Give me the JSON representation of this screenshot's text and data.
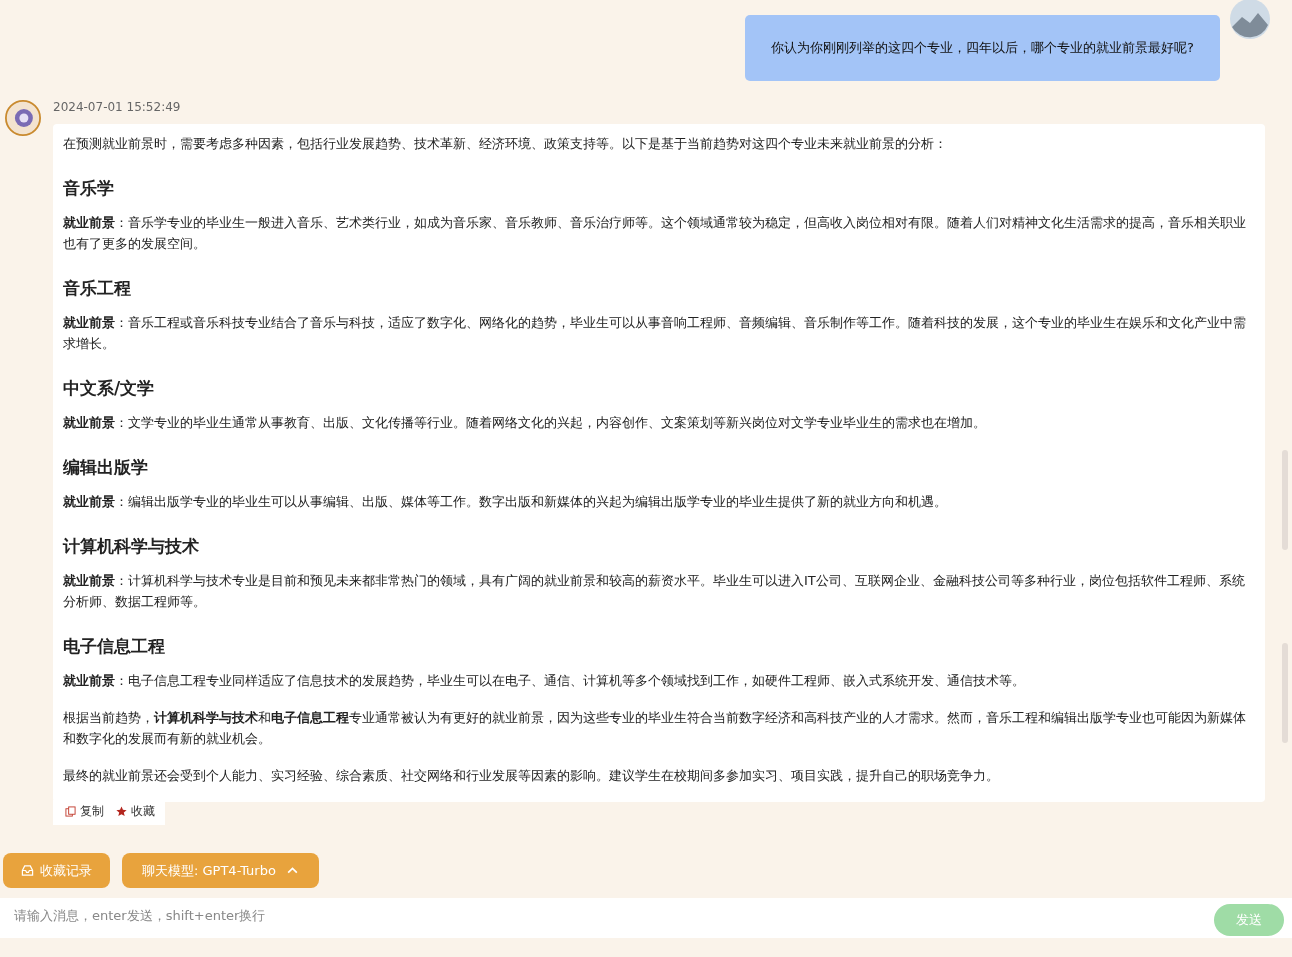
{
  "user_message": {
    "text": "你认为你刚刚列举的这四个专业，四年以后，哪个专业的就业前景最好呢?"
  },
  "reply": {
    "timestamp": "2024-07-01 15:52:49",
    "intro": "在预测就业前景时，需要考虑多种因素，包括行业发展趋势、技术革新、经济环境、政策支持等。以下是基于当前趋势对这四个专业未来就业前景的分析：",
    "sections": [
      {
        "heading": "音乐学",
        "text": "**就业前景**：音乐学专业的毕业生一般进入音乐、艺术类行业，如成为音乐家、音乐教师、音乐治疗师等。这个领域通常较为稳定，但高收入岗位相对有限。随着人们对精神文化生活需求的提高，音乐相关职业也有了更多的发展空间。"
      },
      {
        "heading": "音乐工程",
        "text": "**就业前景**：音乐工程或音乐科技专业结合了音乐与科技，适应了数字化、网络化的趋势，毕业生可以从事音响工程师、音频编辑、音乐制作等工作。随着科技的发展，这个专业的毕业生在娱乐和文化产业中需求增长。"
      },
      {
        "heading": "中文系/文学",
        "text": "**就业前景**：文学专业的毕业生通常从事教育、出版、文化传播等行业。随着网络文化的兴起，内容创作、文案策划等新兴岗位对文学专业毕业生的需求也在增加。"
      },
      {
        "heading": "编辑出版学",
        "text": "**就业前景**：编辑出版学专业的毕业生可以从事编辑、出版、媒体等工作。数字出版和新媒体的兴起为编辑出版学专业的毕业生提供了新的就业方向和机遇。"
      },
      {
        "heading": "计算机科学与技术",
        "text": "**就业前景**：计算机科学与技术专业是目前和预见未来都非常热门的领域，具有广阔的就业前景和较高的薪资水平。毕业生可以进入IT公司、互联网企业、金融科技公司等多种行业，岗位包括软件工程师、系统分析师、数据工程师等。"
      },
      {
        "heading": "电子信息工程",
        "text": "**就业前景**：电子信息工程专业同样适应了信息技术的发展趋势，毕业生可以在电子、通信、计算机等多个领域找到工作，如硬件工程师、嵌入式系统开发、通信技术等。"
      }
    ],
    "conclusions": [
      "根据当前趋势，**计算机科学与技术**和**电子信息工程**专业通常被认为有更好的就业前景，因为这些专业的毕业生符合当前数字经济和高科技产业的人才需求。然而，音乐工程和编辑出版学专业也可能因为新媒体和数字化的发展而有新的就业机会。",
      "最终的就业前景还会受到个人能力、实习经验、综合素质、社交网络和行业发展等因素的影响。建议学生在校期间多参加实习、项目实践，提升自己的职场竞争力。"
    ],
    "actions": [
      {
        "kind": "copy",
        "label": "复制"
      },
      {
        "kind": "favorite",
        "label": "收藏"
      }
    ]
  },
  "toolbar": {
    "favorites_button": "收藏记录",
    "model_button": "聊天模型: GPT4-Turbo"
  },
  "composer": {
    "placeholder": "请输入消息，enter发送，shift+enter换行",
    "send_button": "发送"
  }
}
